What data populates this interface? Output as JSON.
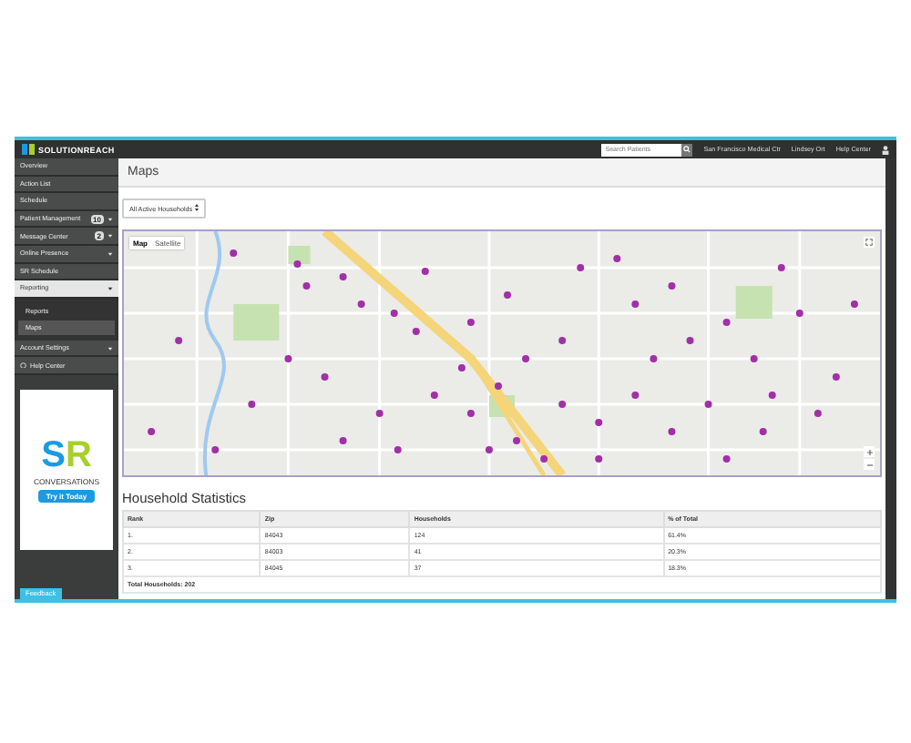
{
  "topbar": {
    "brand": "SOLUTIONREACH",
    "search": {
      "placeholder": "Search Patients"
    },
    "location": "San Francisco Medical Ctr",
    "user": "Lindsey Ort",
    "help": "Help Center"
  },
  "sidebar": {
    "items": [
      {
        "label": "Overview",
        "kind": "plain",
        "selected": false
      },
      {
        "label": "Action List",
        "kind": "plain",
        "selected": false
      },
      {
        "label": "Schedule",
        "kind": "plain",
        "selected": false
      },
      {
        "label": "Patient Management",
        "kind": "menu",
        "badge": "10",
        "selected": false
      },
      {
        "label": "Message Center",
        "kind": "menu",
        "badge": "2",
        "selected": false
      },
      {
        "label": "Online Presence",
        "kind": "menu",
        "selected": false
      },
      {
        "label": "SR Schedule",
        "kind": "plain",
        "selected": false
      },
      {
        "label": "Reporting",
        "kind": "menu",
        "selected": true,
        "children": [
          {
            "label": "Reports",
            "selected": false
          },
          {
            "label": "Maps",
            "selected": true
          }
        ]
      },
      {
        "label": "Account Settings",
        "kind": "menu",
        "selected": false
      },
      {
        "label": "Help Center",
        "kind": "help",
        "selected": false
      }
    ]
  },
  "ad": {
    "mark_left": "S",
    "mark_right": "R",
    "tagline": "CONVERSATIONS",
    "button": "Try it Today"
  },
  "feedback": "Feedback",
  "page": {
    "title": "Maps",
    "filter": "All Active Households",
    "map": {
      "kind": "picture",
      "types": [
        {
          "label": "Map",
          "selected": true
        },
        {
          "label": "Satellite",
          "selected": false
        }
      ]
    }
  },
  "stats": {
    "title": "Household Statistics",
    "columns": [
      "Rank",
      "Zip",
      "Households",
      "% of Total"
    ],
    "rows": [
      [
        "1.",
        "84043",
        "124",
        "61.4%"
      ],
      [
        "2.",
        "84003",
        "41",
        "20.3%"
      ],
      [
        "3.",
        "84045",
        "37",
        "18.3%"
      ]
    ],
    "total": "Total Households: 202"
  }
}
